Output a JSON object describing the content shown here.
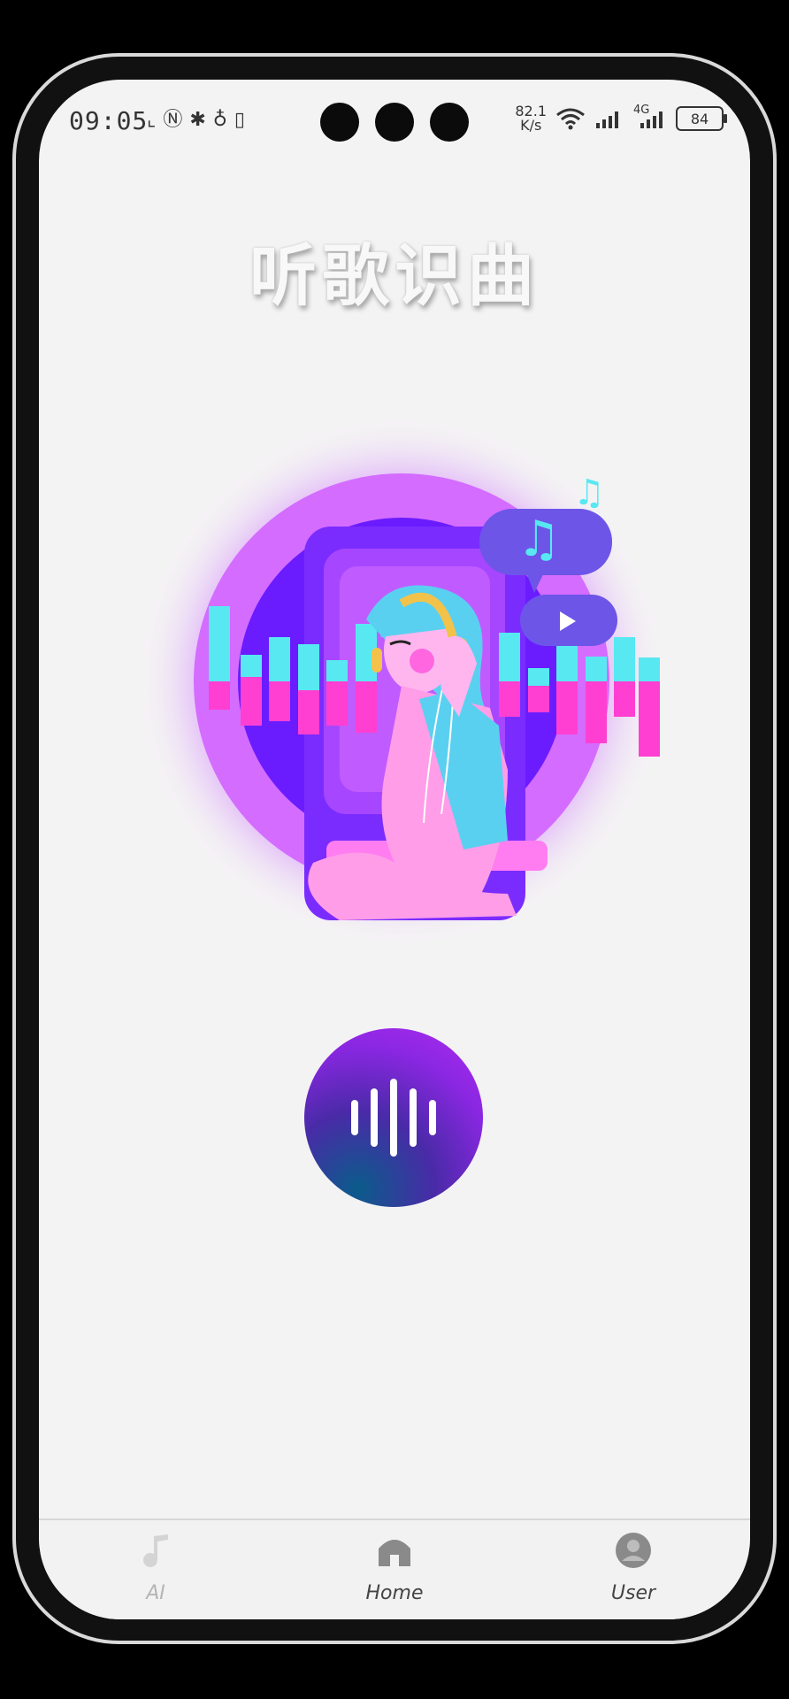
{
  "status_bar": {
    "time": "09:05",
    "net_speed_value": "82.1",
    "net_speed_unit": "K/s",
    "network": "4G",
    "battery": "84"
  },
  "header": {
    "title": "听歌识曲"
  },
  "tab_bar": {
    "items": [
      {
        "label": "AI",
        "icon": "music-note-icon",
        "active": false
      },
      {
        "label": "Home",
        "icon": "home-icon",
        "active": true
      },
      {
        "label": "User",
        "icon": "user-icon",
        "active": true
      }
    ]
  },
  "colors": {
    "accent_purple": "#8a27e2",
    "accent_blue": "#0a5c8a",
    "inactive_tab": "#b5b5b5",
    "active_tab": "#444444"
  }
}
